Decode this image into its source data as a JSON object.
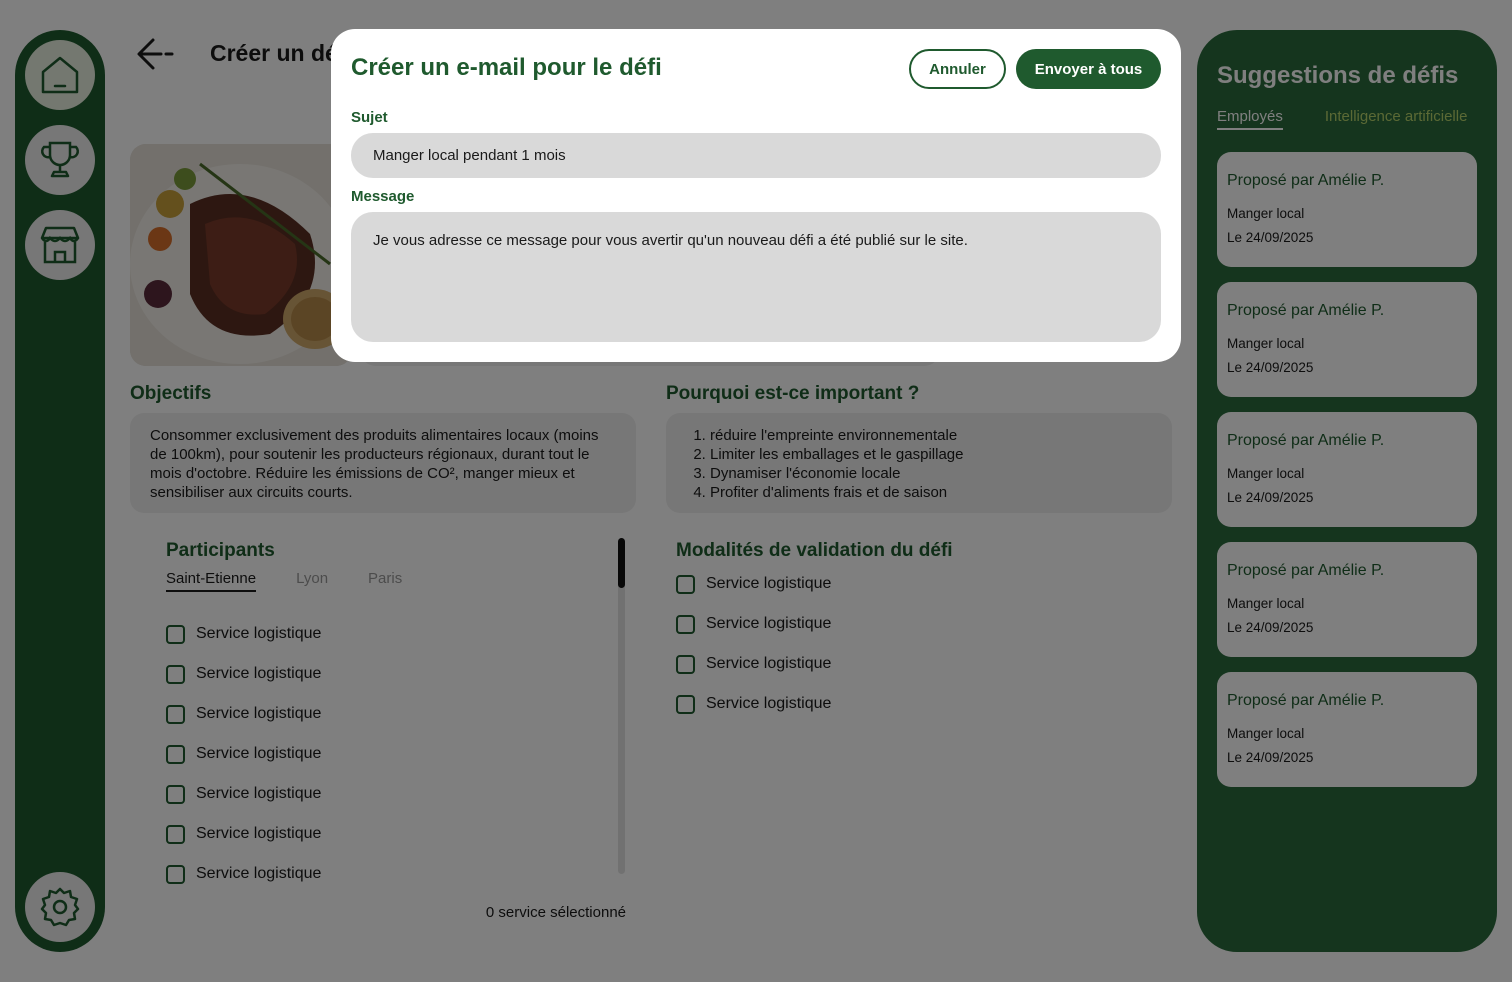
{
  "page": {
    "title": "Créer un défi",
    "objectives": {
      "heading": "Objectifs",
      "text": "Consommer exclusivement des produits alimentaires locaux (moins de 100km), pour soutenir les producteurs régionaux, durant tout le mois d'octobre. Réduire les émissions de CO², manger mieux et sensibiliser aux circuits courts."
    },
    "importance": {
      "heading": "Pourquoi est-ce important ?",
      "items": [
        "réduire l'empreinte environnementale",
        "Limiter les emballages et le gaspillage",
        "Dynamiser l'économie locale",
        "Profiter d'aliments frais et de saison"
      ]
    },
    "participants": {
      "heading": "Participants",
      "tabs": [
        "Saint-Etienne",
        "Lyon",
        "Paris"
      ],
      "services": [
        "Service logistique",
        "Service logistique",
        "Service logistique",
        "Service logistique",
        "Service logistique",
        "Service logistique",
        "Service logistique"
      ],
      "selected_count_label": "0 service sélectionné"
    },
    "validation": {
      "heading": "Modalités de validation du défi",
      "items": [
        "Service logistique",
        "Service logistique",
        "Service logistique",
        "Service logistique"
      ]
    }
  },
  "suggestions": {
    "title": "Suggestions de défis",
    "tabs": [
      "Employés",
      "Intelligence artificielle"
    ],
    "cards": [
      {
        "author": "Proposé par Amélie P.",
        "challenge": "Manger local",
        "date": "Le 24/09/2025"
      },
      {
        "author": "Proposé par Amélie P.",
        "challenge": "Manger local",
        "date": "Le 24/09/2025"
      },
      {
        "author": "Proposé par Amélie P.",
        "challenge": "Manger local",
        "date": "Le 24/09/2025"
      },
      {
        "author": "Proposé par Amélie P.",
        "challenge": "Manger local",
        "date": "Le 24/09/2025"
      },
      {
        "author": "Proposé par Amélie P.",
        "challenge": "Manger local",
        "date": "Le 24/09/2025"
      }
    ]
  },
  "modal": {
    "title": "Créer un e-mail pour le défi",
    "cancel_label": "Annuler",
    "send_label": "Envoyer à tous",
    "subject_label": "Sujet",
    "subject_value": "Manger local pendant 1 mois",
    "message_label": "Message",
    "message_value": "Je vous adresse ce message pour vous avertir qu'un nouveau défi a été publié sur le site."
  },
  "icons": {
    "sidebar": [
      "home-icon",
      "trophy-icon",
      "store-icon",
      "gear-icon"
    ],
    "header": "back-arrow-icon"
  },
  "colors": {
    "brand_green": "#1f5a2e",
    "panel_green": "#2b6b3c",
    "accent_lime": "#b6d36a",
    "field_gray": "#d9d9d9"
  }
}
